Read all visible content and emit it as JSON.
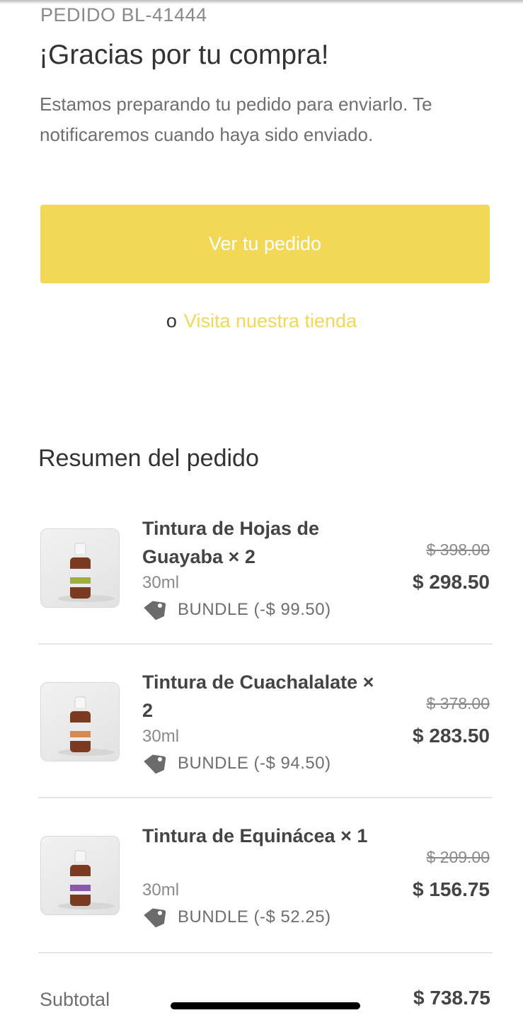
{
  "order": {
    "number_label": "PEDIDO BL-41444",
    "thanks_title": "¡Gracias por tu compra!",
    "intro_text": "Estamos preparando tu pedido para enviarlo. Te notificaremos cuando haya sido enviado."
  },
  "actions": {
    "view_order_label": "Ver tu pedido",
    "or_text": "o",
    "visit_store_label": "Visita nuestra tienda"
  },
  "summary": {
    "title": "Resumen del pedido",
    "items": [
      {
        "name": "Tintura de Hojas de Guayaba × 2",
        "variant": "30ml",
        "discount": "BUNDLE (-$ 99.50)",
        "original_price": "$ 398.00",
        "price": "$ 298.50",
        "label_color": "#9fae3f",
        "image_icon": "tincture-bottle-icon"
      },
      {
        "name": "Tintura de Cuachalalate × 2",
        "variant": "30ml",
        "discount": "BUNDLE (-$ 94.50)",
        "original_price": "$ 378.00",
        "price": "$ 283.50",
        "label_color": "#d58a52",
        "image_icon": "tincture-bottle-icon"
      },
      {
        "name": "Tintura de Equinácea × 1",
        "variant": "30ml",
        "discount": "BUNDLE (-$ 52.25)",
        "original_price": "$ 209.00",
        "price": "$ 156.75",
        "label_color": "#8a5aa8",
        "image_icon": "tincture-bottle-icon"
      }
    ],
    "subtotal_label": "Subtotal",
    "subtotal_value": "$ 738.75"
  },
  "colors": {
    "accent": "#f2d856",
    "text_dark": "#333333",
    "text_muted": "#8a8a8a"
  }
}
